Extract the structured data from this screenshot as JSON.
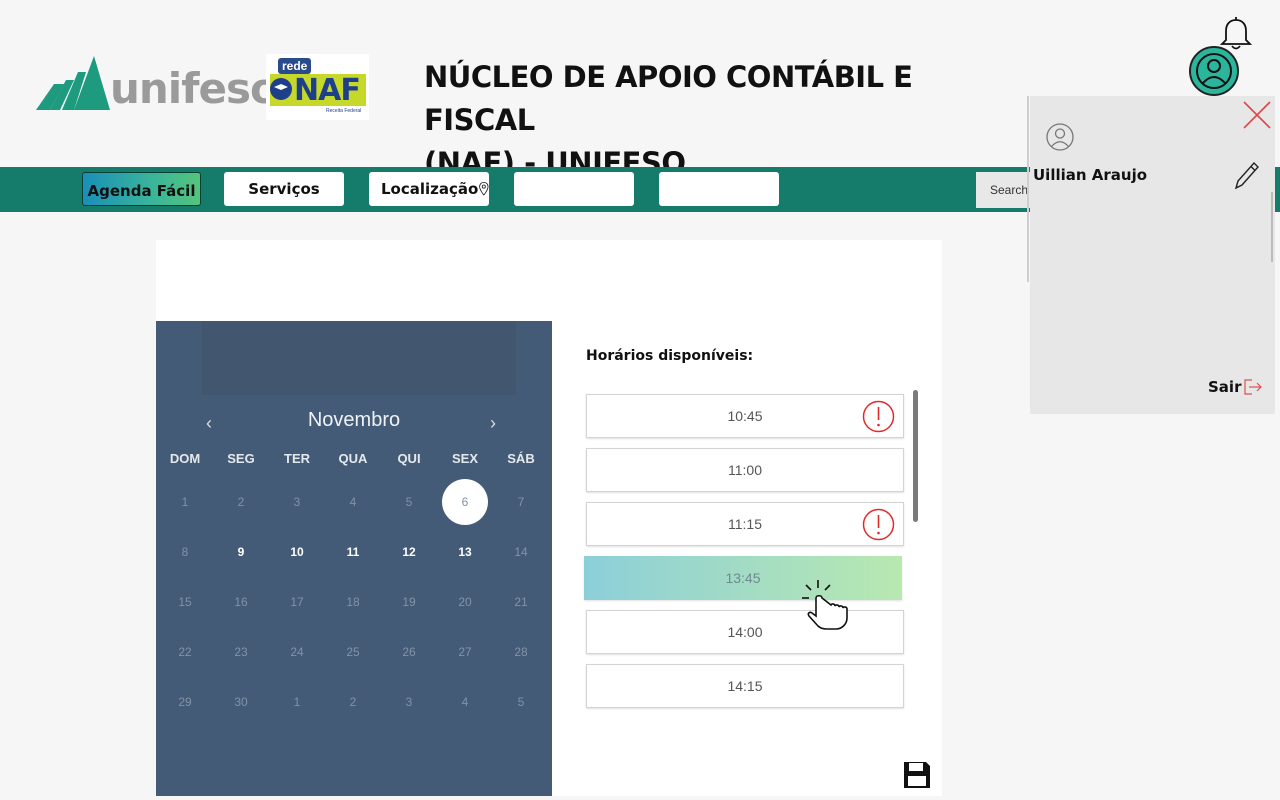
{
  "header": {
    "logo_text": "unifeso",
    "partner_logo": {
      "top": "rede",
      "main": "NAF",
      "footer": "Receita Federal"
    },
    "title_line1": "NÚCLEO DE APOIO CONTÁBIL E FISCAL",
    "title_line2": "(NAF) - UNIFESO"
  },
  "nav": {
    "items": [
      {
        "label": "Agenda Fácil",
        "active": true
      },
      {
        "label": "Serviços",
        "active": false
      },
      {
        "label": "Localização",
        "active": false,
        "icon": "map-pin-icon"
      },
      {
        "label": "",
        "active": false
      },
      {
        "label": "",
        "active": false
      }
    ],
    "search_label": "Search"
  },
  "profile_panel": {
    "user_name": "Uillian Araujo",
    "logout_label": "Sair"
  },
  "calendar": {
    "month": "Novembro",
    "weekdays": [
      "DOM",
      "SEG",
      "TER",
      "QUA",
      "QUI",
      "SEX",
      "SÁB"
    ],
    "weeks": [
      [
        {
          "d": "1",
          "s": "dim"
        },
        {
          "d": "2",
          "s": "dim"
        },
        {
          "d": "3",
          "s": "dim"
        },
        {
          "d": "4",
          "s": "dim"
        },
        {
          "d": "5",
          "s": "dim"
        },
        {
          "d": "6",
          "s": "selected"
        },
        {
          "d": "7",
          "s": "dim"
        }
      ],
      [
        {
          "d": "8",
          "s": "dim"
        },
        {
          "d": "9",
          "s": "bright"
        },
        {
          "d": "10",
          "s": "bright"
        },
        {
          "d": "11",
          "s": "bright"
        },
        {
          "d": "12",
          "s": "bright"
        },
        {
          "d": "13",
          "s": "bright"
        },
        {
          "d": "14",
          "s": "dim"
        }
      ],
      [
        {
          "d": "15",
          "s": "dim"
        },
        {
          "d": "16",
          "s": "dim"
        },
        {
          "d": "17",
          "s": "dim"
        },
        {
          "d": "18",
          "s": "dim"
        },
        {
          "d": "19",
          "s": "dim"
        },
        {
          "d": "20",
          "s": "dim"
        },
        {
          "d": "21",
          "s": "dim"
        }
      ],
      [
        {
          "d": "22",
          "s": "dim"
        },
        {
          "d": "23",
          "s": "dim"
        },
        {
          "d": "24",
          "s": "dim"
        },
        {
          "d": "25",
          "s": "dim"
        },
        {
          "d": "26",
          "s": "dim"
        },
        {
          "d": "27",
          "s": "dim"
        },
        {
          "d": "28",
          "s": "dim"
        }
      ],
      [
        {
          "d": "29",
          "s": "dim"
        },
        {
          "d": "30",
          "s": "dim"
        },
        {
          "d": "1",
          "s": "dim"
        },
        {
          "d": "2",
          "s": "dim"
        },
        {
          "d": "3",
          "s": "dim"
        },
        {
          "d": "4",
          "s": "dim"
        },
        {
          "d": "5",
          "s": "dim"
        }
      ]
    ],
    "selected_day": "6"
  },
  "slots": {
    "title": "Horários disponíveis:",
    "items": [
      {
        "time": "10:45",
        "warning": true,
        "selected": false
      },
      {
        "time": "11:00",
        "warning": false,
        "selected": false
      },
      {
        "time": "11:15",
        "warning": true,
        "selected": false
      },
      {
        "time": "13:45",
        "warning": false,
        "selected": true
      },
      {
        "time": "14:00",
        "warning": false,
        "selected": false
      },
      {
        "time": "14:15",
        "warning": false,
        "selected": false
      }
    ]
  },
  "colors": {
    "nav_bg": "#157c6c",
    "calendar_bg": "#445b77",
    "warning": "#e02a2a",
    "logout_accent": "#e05050"
  }
}
